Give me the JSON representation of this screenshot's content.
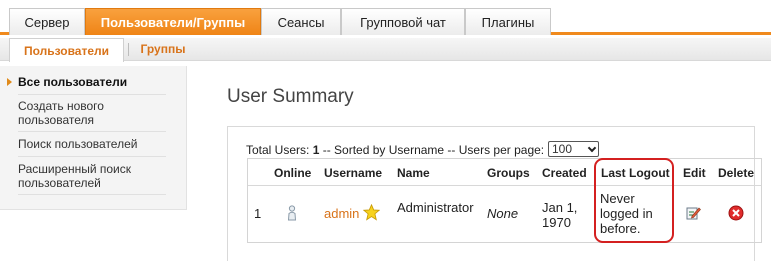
{
  "top_tabs": [
    "Сервер",
    "Пользователи/Группы",
    "Сеансы",
    "Групповой чат",
    "Плагины"
  ],
  "sub_tabs": [
    "Пользователи",
    "Группы"
  ],
  "sidebar": {
    "items": [
      {
        "label": "Все пользователи",
        "active": true
      },
      {
        "label": "Создать нового пользователя"
      },
      {
        "label": "Поиск пользователей"
      },
      {
        "label": "Расширенный поиск пользователей"
      }
    ]
  },
  "main": {
    "title": "User Summary",
    "summary_prefix": "Total Users: ",
    "total_users": "1",
    "summary_suffix": " -- Sorted by Username -- Users per page:",
    "per_page": "100"
  },
  "table": {
    "columns": [
      "Online",
      "Username",
      "Name",
      "Groups",
      "Created",
      "Last Logout",
      "Edit",
      "Delete"
    ],
    "rows": [
      {
        "index": "1",
        "username": "admin",
        "name": "Administrator",
        "groups": "None",
        "created": [
          "Jan 1,",
          "1970"
        ],
        "last_logout": [
          "Never",
          "logged in",
          "before."
        ]
      }
    ]
  },
  "colors": {
    "accent": "#f08a1d",
    "link": "#d8731a",
    "highlight": "#d42020"
  },
  "icons": [
    "user-offline-icon",
    "star-icon",
    "edit-icon",
    "delete-icon"
  ]
}
